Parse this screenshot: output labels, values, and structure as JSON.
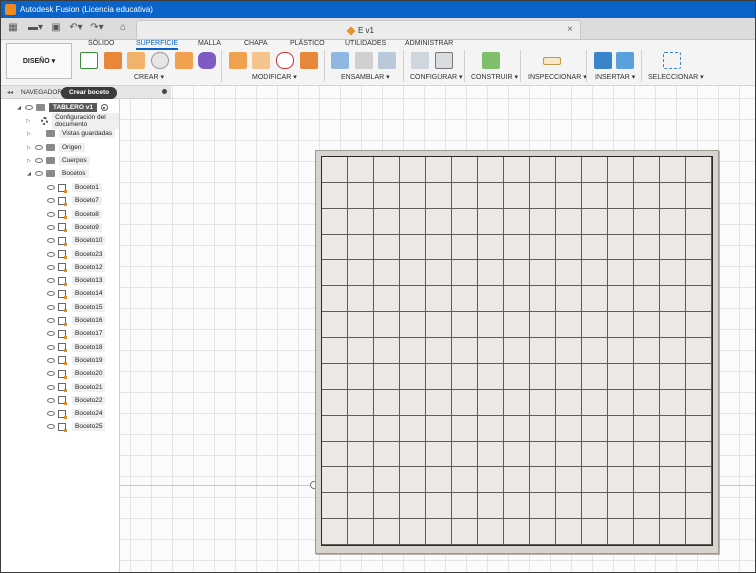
{
  "window": {
    "title": "Autodesk Fusion (Licencia educativa)"
  },
  "document": {
    "tab_title": "E v1",
    "close_glyph": "×"
  },
  "workspace": {
    "label": "DISEÑO ▾"
  },
  "ribbon": {
    "tabs": [
      "SÓLIDO",
      "SUPERFICIE",
      "MALLA",
      "CHAPA",
      "PLÁSTICO",
      "UTILIDADES",
      "ADMINISTRAR"
    ],
    "active_tab": "SUPERFICIE",
    "groups": [
      "CREAR ▾",
      "MODIFICAR ▾",
      "ENSAMBLAR ▾",
      "CONFIGURAR ▾",
      "CONSTRUIR ▾",
      "INSPECCIONAR ▾",
      "INSERTAR ▾",
      "SELECCIONAR ▾"
    ]
  },
  "browser": {
    "header": "NAVEGADOR",
    "tooltip": "Crear boceto",
    "root": "TABLERO v1",
    "items": [
      "Configuración del documento",
      "Vistas guardadas",
      "Origen",
      "Cuerpos",
      "Bocetos"
    ],
    "sketches": [
      "Boceto1",
      "Boceto7",
      "Boceto8",
      "Boceto9",
      "Boceto10",
      "Boceto23",
      "Boceto12",
      "Boceto13",
      "Boceto14",
      "Boceto15",
      "Boceto16",
      "Boceto17",
      "Boceto18",
      "Boceto19",
      "Boceto20",
      "Boceto21",
      "Boceto22",
      "Boceto24",
      "Boceto25"
    ]
  },
  "board": {
    "columns": 15,
    "rows": 15
  },
  "colors": {
    "titlebar": "#0a63c9",
    "accent": "#0a63c9",
    "board_fill": "#ece9e4",
    "board_lines": "#5c5c5c"
  },
  "icons": [
    "apps-grid-icon",
    "file-icon",
    "save-icon",
    "undo-icon",
    "redo-icon",
    "home-icon",
    "eye-icon",
    "folder-icon",
    "gear-icon",
    "sketch-icon"
  ]
}
